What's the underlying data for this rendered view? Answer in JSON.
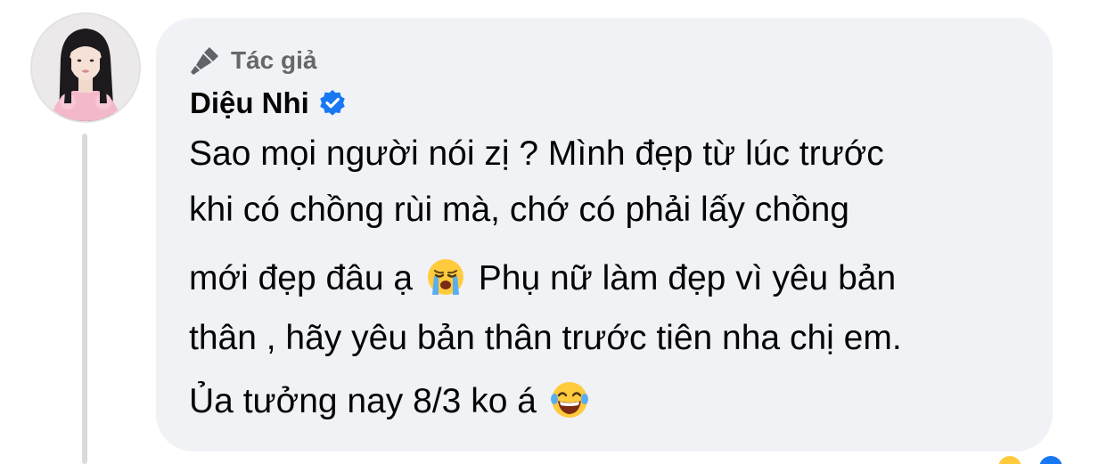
{
  "comment": {
    "badge": {
      "icon": "microphone-icon",
      "label": "Tác giả"
    },
    "author": {
      "name": "Diệu Nhi",
      "verified_icon": "verified-badge-icon",
      "verified_color": "#1877f2"
    },
    "body": {
      "lines": [
        {
          "text": "Sao mọi người nói zị ? Mình đẹp từ lúc trước"
        },
        {
          "text": "khi có chồng rùi mà, chớ có phải lấy chồng"
        },
        {
          "before": "mới đẹp đâu ạ",
          "emoji": "loudly-crying-face-emoji",
          "after": "Phụ nữ làm đẹp vì yêu bản"
        },
        {
          "text": "thân , hãy yêu bản thân trước tiên nha chị em."
        },
        {
          "before": "Ủa tưởng nay 8/3 ko á",
          "emoji": "face-with-tears-of-joy-emoji",
          "after": ""
        }
      ]
    }
  },
  "colors": {
    "bubble_bg": "#f0f2f5",
    "text_primary": "#050505",
    "text_secondary": "#65676b",
    "thread_line": "#d9dadd"
  }
}
